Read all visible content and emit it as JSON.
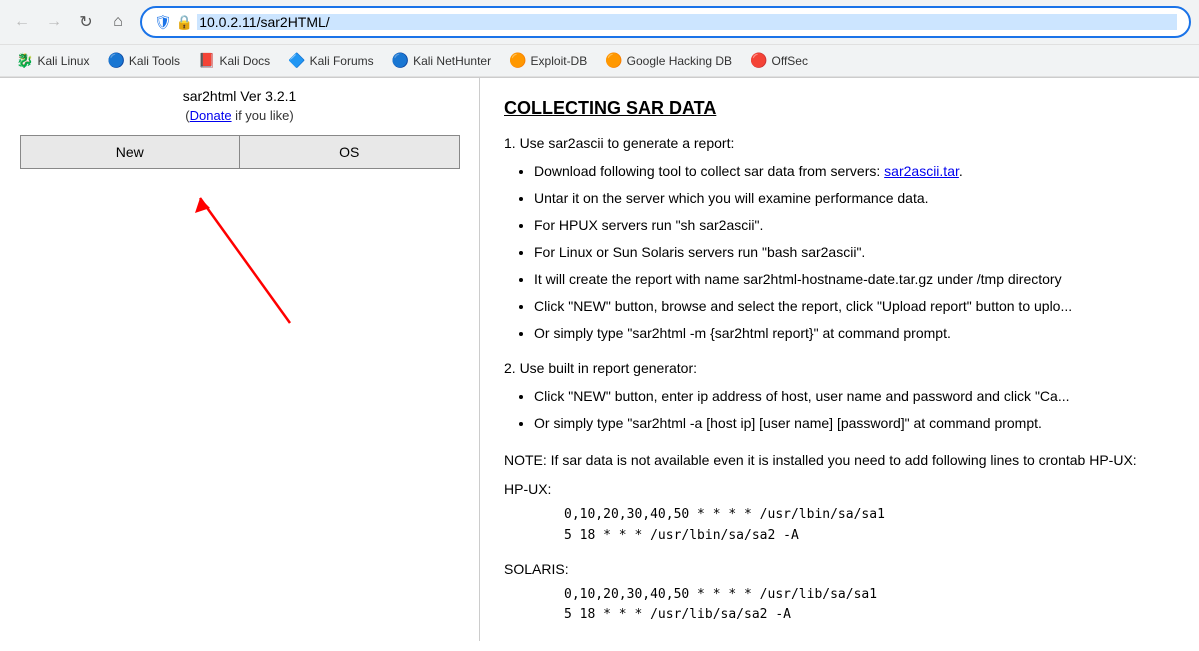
{
  "browser": {
    "back_disabled": true,
    "forward_disabled": true,
    "reload_label": "↻",
    "home_label": "⌂",
    "address": "10.0.2.11/sar2HTML/",
    "shield_icon": "🛡",
    "lock_icon": "🔒"
  },
  "bookmarks": [
    {
      "id": "kali-linux",
      "icon": "🐉",
      "label": "Kali Linux"
    },
    {
      "id": "kali-tools",
      "icon": "🔵",
      "label": "Kali Tools"
    },
    {
      "id": "kali-docs",
      "icon": "📕",
      "label": "Kali Docs"
    },
    {
      "id": "kali-forums",
      "icon": "🔷",
      "label": "Kali Forums"
    },
    {
      "id": "kali-nethunter",
      "icon": "🔵",
      "label": "Kali NetHunter"
    },
    {
      "id": "exploit-db",
      "icon": "🟠",
      "label": "Exploit-DB"
    },
    {
      "id": "google-hacking",
      "icon": "🟠",
      "label": "Google Hacking DB"
    },
    {
      "id": "offsec",
      "icon": "🔴",
      "label": "OffSec"
    }
  ],
  "sidebar": {
    "title": "sar2html Ver 3.2.1",
    "subtitle_pre": "(",
    "donate_label": "Donate",
    "subtitle_post": " if you like)",
    "new_button": "New",
    "os_button": "OS"
  },
  "main": {
    "title": "COLLECTING SAR DATA",
    "step1_label": "1. Use sar2ascii to generate a report:",
    "bullets1": [
      {
        "text": "Download following tool to collect sar data from servers: ",
        "link": "sar2ascii.tar",
        "link_suffix": "."
      },
      {
        "text": "Untar it on the server which you will examine performance data.",
        "link": null
      },
      {
        "text": "For HPUX servers run \"sh sar2ascii\".",
        "link": null
      },
      {
        "text": "For Linux or Sun Solaris servers run \"bash sar2ascii\".",
        "link": null
      },
      {
        "text": "It will create the report with name sar2html-hostname-date.tar.gz under /tmp directory",
        "link": null
      },
      {
        "text": "Click \"NEW\" button, browse and select the report, click \"Upload report\" button to uplo...",
        "link": null
      },
      {
        "text": "Or simply type \"sar2html -m {sar2html report}\" at command prompt.",
        "link": null
      }
    ],
    "step2_label": "2. Use built in report generator:",
    "bullets2": [
      {
        "text": "Click \"NEW\" button, enter ip address of host, user name and password and click \"Ca...",
        "link": null
      },
      {
        "text": "Or simply type \"sar2html -a [host ip] [user name] [password]\" at command prompt.",
        "link": null
      }
    ],
    "note": "NOTE: If sar data is not available even it is installed you need to add following lines to crontab HP-UX:",
    "hpux_label": "HP-UX:",
    "hpux_code": [
      "0,10,20,30,40,50 * * * * /usr/lbin/sa/sa1",
      "5 18 * * * /usr/lbin/sa/sa2 -A"
    ],
    "solaris_label": "SOLARIS:",
    "solaris_code": [
      "0,10,20,30,40,50 * * * * /usr/lib/sa/sa1",
      "5 18 * * * /usr/lib/sa/sa2 -A"
    ]
  }
}
